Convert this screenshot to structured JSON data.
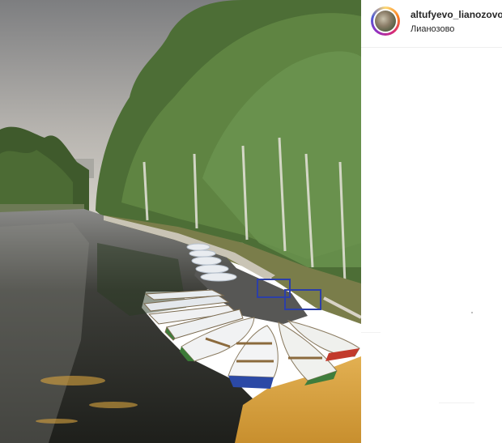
{
  "post": {
    "username": "altufyevo_lianozovo",
    "location": "Лианозово"
  },
  "icons": {
    "avatar": "profile-avatar"
  },
  "colors": {
    "accent_ring": "#d62976",
    "text": "#262626",
    "divider": "#efefef"
  }
}
